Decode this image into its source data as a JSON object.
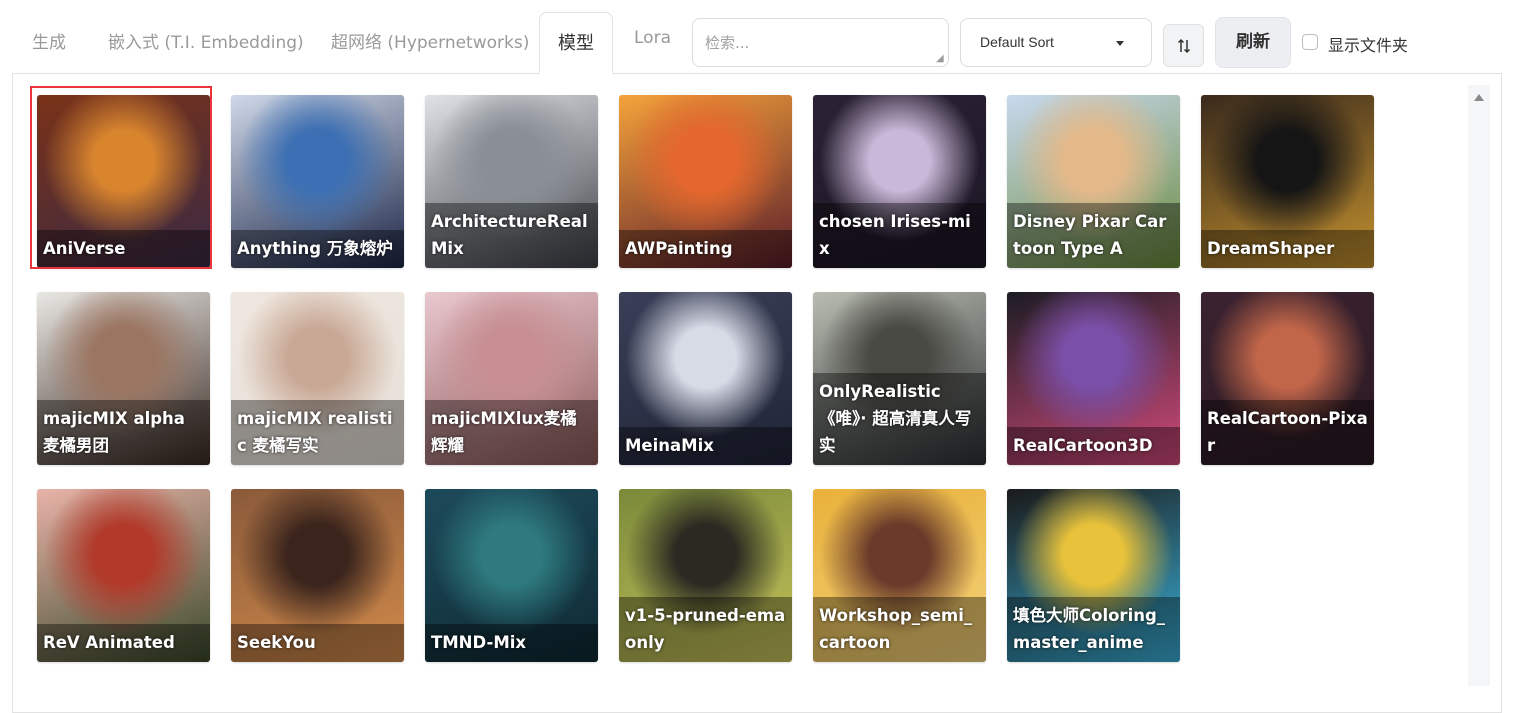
{
  "tabs": [
    {
      "label": "生成",
      "active": false
    },
    {
      "label": "嵌入式 (T.I. Embedding)",
      "active": false
    },
    {
      "label": "超网络 (Hypernetworks)",
      "active": false
    },
    {
      "label": "模型",
      "active": true
    },
    {
      "label": "Lora",
      "active": false
    }
  ],
  "search": {
    "placeholder": "检索...",
    "value": ""
  },
  "sort": {
    "selected": "Default Sort",
    "direction_icon": "sort-direction-icon"
  },
  "refresh_label": "刷新",
  "show_folders": {
    "label": "显示文件夹",
    "checked": false
  },
  "selected_card": "AniVerse",
  "cards": [
    {
      "name": "AniVerse",
      "colors": [
        "#7a3218",
        "#d9852e",
        "#3a2a44"
      ]
    },
    {
      "name": "Anything 万象熔炉",
      "colors": [
        "#cfd8e8",
        "#3c6fb3",
        "#1d2748"
      ]
    },
    {
      "name": "ArchitectureRealMix",
      "colors": [
        "#dfe2e6",
        "#8a8f96",
        "#3e4248"
      ]
    },
    {
      "name": "AWPainting",
      "colors": [
        "#f4a33a",
        "#e5672e",
        "#5b1d2a"
      ]
    },
    {
      "name": "chosen Irises-mix",
      "colors": [
        "#2b2233",
        "#c9b8d8",
        "#1b1524"
      ]
    },
    {
      "name": "Disney Pixar Cartoon Type A",
      "colors": [
        "#c8d9ee",
        "#e4b98a",
        "#6a8a3c"
      ]
    },
    {
      "name": "DreamShaper",
      "colors": [
        "#3a2a1c",
        "#151515",
        "#c2902e"
      ]
    },
    {
      "name": "majicMIX alpha 麦橘男团",
      "colors": [
        "#e9e7e4",
        "#9b7560",
        "#3a2a22"
      ]
    },
    {
      "name": "majicMIX realistic 麦橘写实",
      "colors": [
        "#efe7df",
        "#c9a996",
        "#e6e0d8"
      ]
    },
    {
      "name": "majicMIXlux麦橘辉耀",
      "colors": [
        "#e9c8cf",
        "#c78f93",
        "#8e5a5a"
      ]
    },
    {
      "name": "MeinaMix",
      "colors": [
        "#3a3f58",
        "#d7dbe6",
        "#1f2436"
      ]
    },
    {
      "name": "OnlyRealistic 《唯》· 超高清真人写实",
      "colors": [
        "#b8bcb0",
        "#4a4a44",
        "#2c2f33"
      ]
    },
    {
      "name": "RealCartoon3D",
      "colors": [
        "#1c1c24",
        "#7a4fa8",
        "#d24a7a"
      ]
    },
    {
      "name": "RealCartoon-Pixar",
      "colors": [
        "#3b2230",
        "#c2664a",
        "#2a1a22"
      ]
    },
    {
      "name": "ReV Animated",
      "colors": [
        "#e8b3a8",
        "#b23a2a",
        "#3a4a2a"
      ]
    },
    {
      "name": "SeekYou",
      "colors": [
        "#8a5a3a",
        "#3a241c",
        "#d18a4a"
      ]
    },
    {
      "name": "TMND-Mix",
      "colors": [
        "#1d4a5a",
        "#2e7a7e",
        "#0f2a34"
      ]
    },
    {
      "name": "v1-5-pruned-emaonly",
      "colors": [
        "#7a8a3a",
        "#2a2a22",
        "#c6c25a"
      ]
    },
    {
      "name": "Workshop_semi_cartoon",
      "colors": [
        "#e9b13a",
        "#6a3a2a",
        "#f2d27a"
      ]
    },
    {
      "name": "填色大师Coloring_master_anime",
      "colors": [
        "#1a1a1a",
        "#e8c23a",
        "#3ab0d8"
      ]
    }
  ]
}
